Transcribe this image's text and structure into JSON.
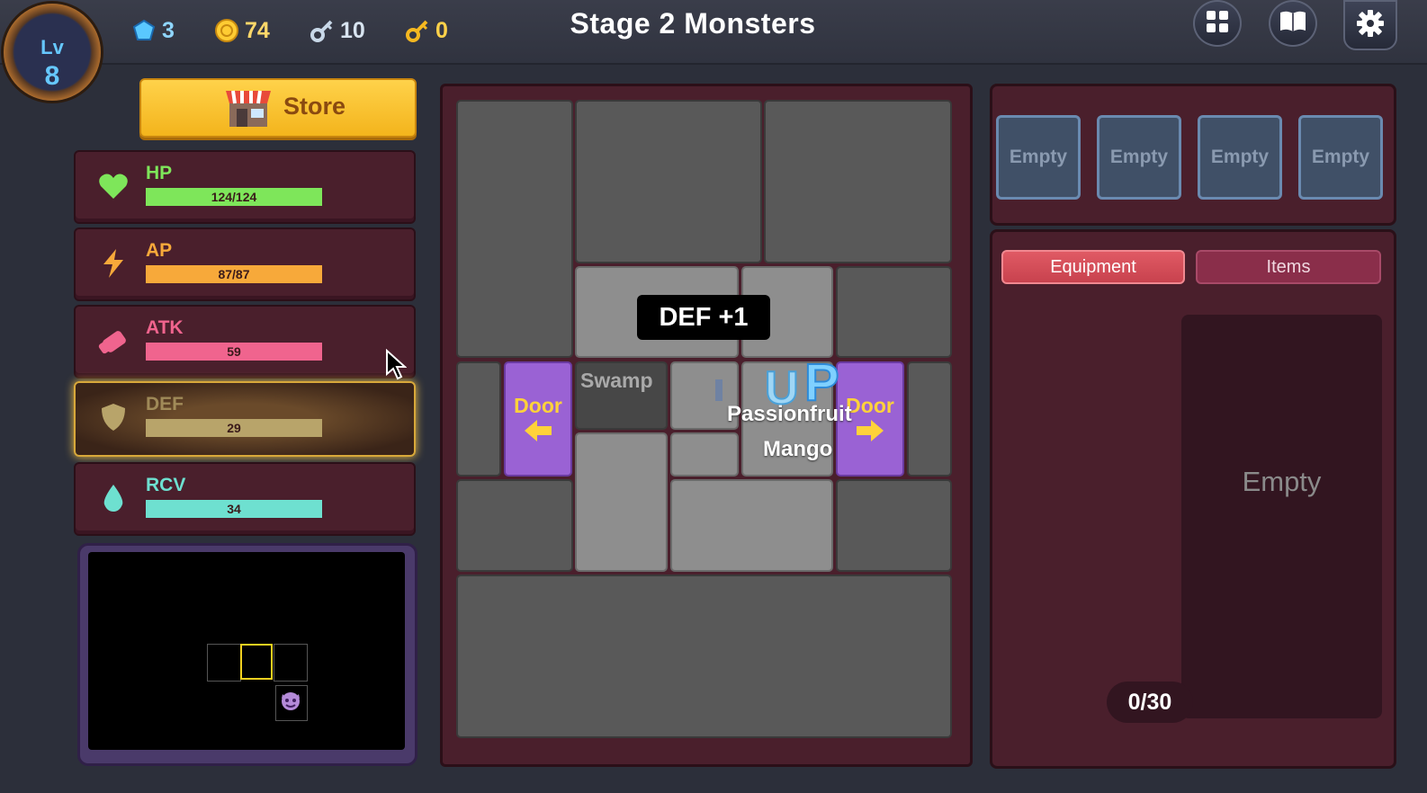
{
  "header": {
    "title": "Stage 2  Monsters",
    "level_label": "Lv",
    "level_value": "8",
    "gems": "3",
    "coins": "74",
    "silver_keys": "10",
    "gold_keys": "0"
  },
  "store": {
    "label": "Store"
  },
  "stats": [
    {
      "name": "HP",
      "value": "124/124",
      "fill": 1.0,
      "color": "#7ee65a",
      "name_color": "#7ee65a"
    },
    {
      "name": "AP",
      "value": "87/87",
      "fill": 1.0,
      "color": "#f7a93a",
      "name_color": "#f7a93a"
    },
    {
      "name": "ATK",
      "value": "59",
      "fill": 1.0,
      "color": "#f0648e",
      "name_color": "#f0648e"
    },
    {
      "name": "DEF",
      "value": "29",
      "fill": 1.0,
      "color": "#b8a46a",
      "name_color": "#b8a46a"
    },
    {
      "name": "RCV",
      "value": "34",
      "fill": 1.0,
      "color": "#6ee0d0",
      "name_color": "#6ee0d0"
    }
  ],
  "board": {
    "tooltip": "DEF +1",
    "swamp_label": "Swamp",
    "door_left_label": "Door",
    "door_right_label": "Door",
    "passionfruit_label": "Passionfruit",
    "mango_label": "Mango",
    "letters": [
      "U",
      "P"
    ]
  },
  "equip_slots": [
    "Empty",
    "Empty",
    "Empty",
    "Empty"
  ],
  "tabs": {
    "equipment": "Equipment",
    "items": "Items"
  },
  "inventory": {
    "empty_label": "Empty",
    "count": "0/30"
  },
  "colors": {
    "panel": "#4a1f2c",
    "accent_gold": "#ffd24a",
    "door": "#9a62d4"
  }
}
